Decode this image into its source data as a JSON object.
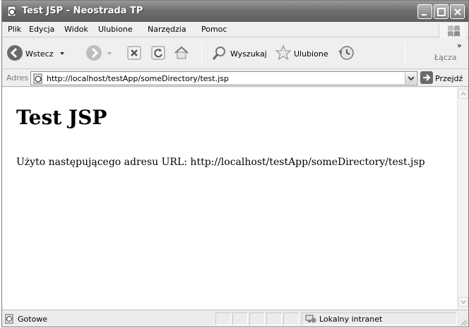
{
  "window": {
    "title": "Test JSP - Neostrada TP"
  },
  "menubar": {
    "items": [
      "Plik",
      "Edycja",
      "Widok",
      "Ulubione",
      "Narzędzia",
      "Pomoc"
    ]
  },
  "toolbar": {
    "back_label": "Wstecz",
    "search_label": "Wyszukaj",
    "favorites_label": "Ulubione",
    "links_label": "Łącza",
    "more_glyph": "»"
  },
  "addressbar": {
    "label": "Adres",
    "url": "http://localhost/testApp/someDirectory/test.jsp",
    "go_label": "Przejdź"
  },
  "page": {
    "heading": "Test JSP",
    "text": "Użyto następującego adresu URL: http://localhost/testApp/someDirectory/test.jsp"
  },
  "statusbar": {
    "status": "Gotowe",
    "zone": "Lokalny intranet"
  }
}
